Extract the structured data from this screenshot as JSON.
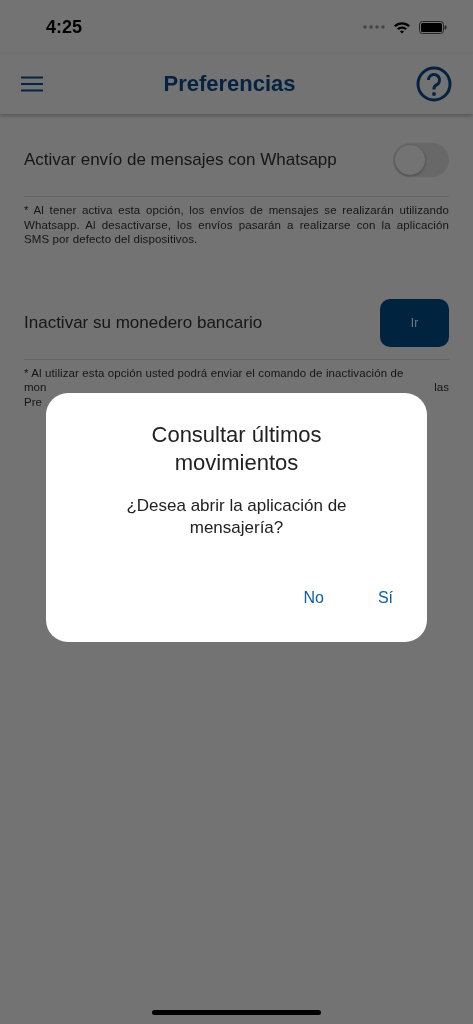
{
  "status_bar": {
    "time": "4:25"
  },
  "nav": {
    "title": "Preferencias"
  },
  "settings": [
    {
      "kind": "toggle",
      "label": "Activar envío de mensajes con Whatsapp",
      "on": false,
      "note_lines": [
        "* Al tener activa esta opción, los envíos de mensajes se realizarán utilizando Whatsapp. Al desactivarse, los envíos pasarán a realizarse con la aplicación SMS por defecto del dispositivos."
      ]
    },
    {
      "kind": "button",
      "label": "Inactivar su monedero bancario",
      "button": "Ir",
      "note_lines": [
        "* Al utilizar esta opción usted podrá enviar el comando de inactivación de"
      ],
      "note_fragments": [
        [
          "mon",
          "las"
        ],
        [
          "Pre"
        ]
      ]
    }
  ],
  "dialog": {
    "title": "Consultar últimos movimientos",
    "message": "¿Desea abrir la aplicación de mensajería?",
    "buttons": [
      "No",
      "Sí"
    ]
  }
}
